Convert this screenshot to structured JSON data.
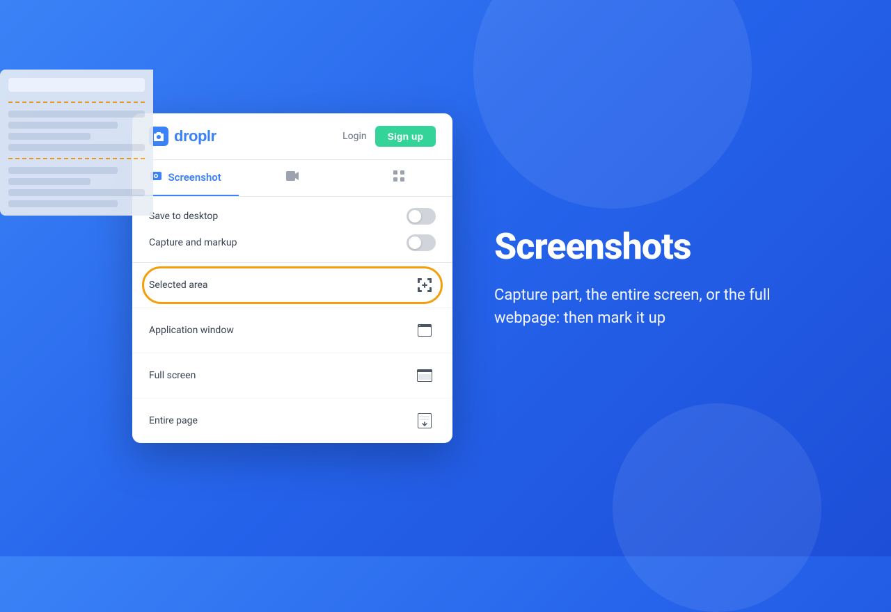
{
  "background": {
    "color_start": "#3b82f6",
    "color_end": "#1d4ed8"
  },
  "header": {
    "logo_text": "droplr",
    "login_label": "Login",
    "signup_label": "Sign up"
  },
  "tabs": [
    {
      "id": "screenshot",
      "label": "Screenshot",
      "active": true
    },
    {
      "id": "video",
      "label": "Video",
      "active": false
    },
    {
      "id": "grid",
      "label": "Grid",
      "active": false
    }
  ],
  "settings": [
    {
      "id": "save-desktop",
      "label": "Save to desktop",
      "enabled": false
    },
    {
      "id": "capture-markup",
      "label": "Capture and markup",
      "enabled": false
    }
  ],
  "options": [
    {
      "id": "selected-area",
      "label": "Selected area",
      "highlighted": true,
      "icon": "crosshair"
    },
    {
      "id": "application-window",
      "label": "Application window",
      "highlighted": false,
      "icon": "window"
    },
    {
      "id": "full-screen",
      "label": "Full screen",
      "highlighted": false,
      "icon": "fullscreen"
    },
    {
      "id": "entire-page",
      "label": "Entire page",
      "highlighted": false,
      "icon": "download-page"
    }
  ],
  "right_panel": {
    "title": "Screenshots",
    "description": "Capture part, the entire screen, or the full webpage: then mark it up"
  }
}
